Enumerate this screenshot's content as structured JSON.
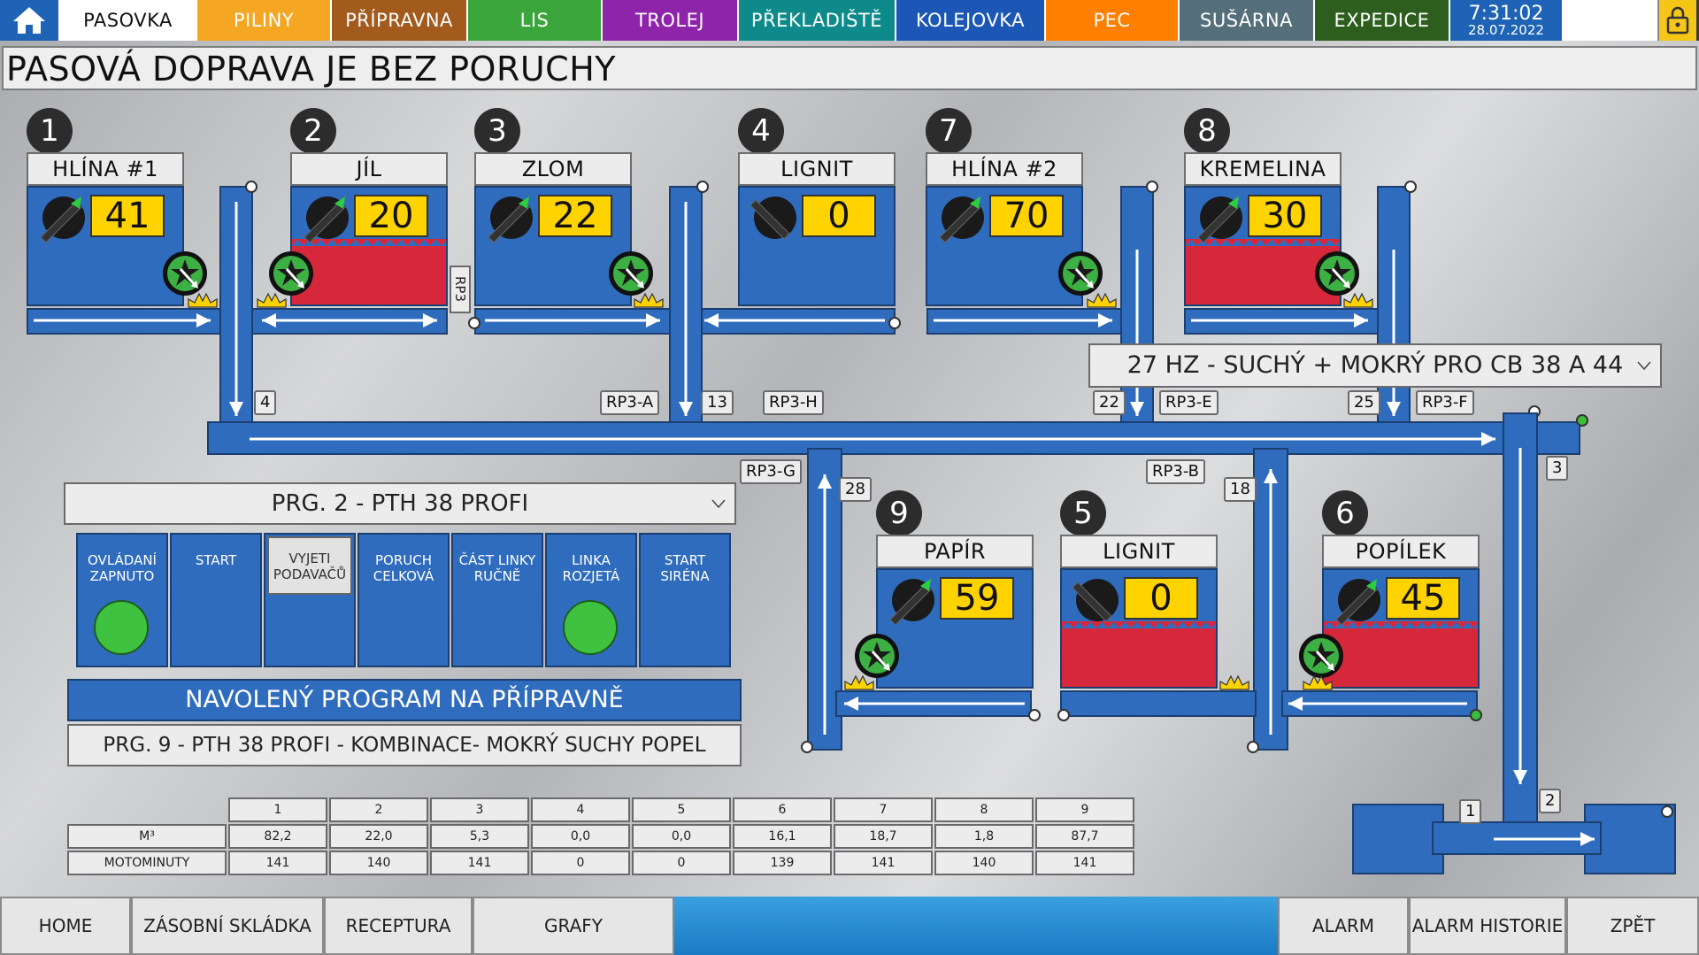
{
  "nav": {
    "tabs": [
      {
        "label": "PASOVKA",
        "color": "#ffffff",
        "active": true,
        "w": 155
      },
      {
        "label": "PILINY",
        "color": "#f5a623",
        "w": 152
      },
      {
        "label": "PŘÍPRAVNA",
        "color": "#a25a1d",
        "w": 154
      },
      {
        "label": "LIS",
        "color": "#3aa53a",
        "w": 152
      },
      {
        "label": "TROLEJ",
        "color": "#8e24aa",
        "w": 154
      },
      {
        "label": "PŘEKLADIŠTĚ",
        "color": "#0e8a8a",
        "w": 178
      },
      {
        "label": "KOLEJOVKA",
        "color": "#1c57b5",
        "w": 169
      },
      {
        "label": "PEC",
        "color": "#ff7f00",
        "w": 151
      },
      {
        "label": "SUŠÁRNA",
        "color": "#546e7a",
        "w": 153
      },
      {
        "label": "EXPEDICE",
        "color": "#2e5e1e",
        "w": 153
      }
    ],
    "time": "7:31:02",
    "date": "28.07.2022"
  },
  "status": "PASOVÁ DOPRAVA JE BEZ PORUCHY",
  "hoppers": [
    {
      "num": "1",
      "name": "HLÍNA #1",
      "value": "41"
    },
    {
      "num": "2",
      "name": "JÍL",
      "value": "20"
    },
    {
      "num": "3",
      "name": "ZLOM",
      "value": "22"
    },
    {
      "num": "4",
      "name": "LIGNIT",
      "value": "0"
    },
    {
      "num": "7",
      "name": "HLÍNA #2",
      "value": "70"
    },
    {
      "num": "8",
      "name": "KREMELINA",
      "value": "30"
    },
    {
      "num": "9",
      "name": "PAPÍR",
      "value": "59"
    },
    {
      "num": "5",
      "name": "LIGNIT",
      "value": "0"
    },
    {
      "num": "6",
      "name": "POPÍLEK",
      "value": "45"
    }
  ],
  "tags": {
    "t4": "4",
    "rp3a": "RP3-A",
    "t13": "13",
    "rp3h": "RP3-H",
    "t22": "22",
    "rp3e": "RP3-E",
    "t25": "25",
    "rp3f": "RP3-F",
    "rp3g": "RP3-G",
    "t28": "28",
    "rp3b": "RP3-B",
    "t18": "18",
    "t3": "3",
    "t1": "1",
    "t2": "2",
    "rp3v": "RP3"
  },
  "mix_select": "27 HZ - SUCHÝ + MOKRÝ PRO CB 38 A 44",
  "program_select": "PRG. 2 - PTH 38 PROFI",
  "controls": [
    {
      "label": "OVLÁDANÍ ZAPNUTO",
      "lamp": true
    },
    {
      "label": "START"
    },
    {
      "label": "VYJETI PODAVAČŮ",
      "pressed": true
    },
    {
      "label": "PORUCH CELKOVÁ"
    },
    {
      "label": "ČÁST LINKY RUČNĚ"
    },
    {
      "label": "LINKA ROZJETÁ",
      "lamp": true
    },
    {
      "label": "START SIRÉNA"
    }
  ],
  "selected_program_title": "NAVOLENÝ PROGRAM NA PŘÍPRAVNĚ",
  "selected_program": "PRG. 9 - PTH 38 PROFI - KOMBINACE- MOKRÝ SUCHY POPEL",
  "table": {
    "headers": [
      "1",
      "2",
      "3",
      "4",
      "5",
      "6",
      "7",
      "8",
      "9"
    ],
    "rows": [
      {
        "label": "M³",
        "values": [
          "82,2",
          "22,0",
          "5,3",
          "0,0",
          "0,0",
          "16,1",
          "18,7",
          "1,8",
          "87,7"
        ]
      },
      {
        "label": "MOTOMINUTY",
        "values": [
          "141",
          "140",
          "141",
          "0",
          "0",
          "139",
          "141",
          "140",
          "141"
        ]
      }
    ]
  },
  "bottom": {
    "home": "HOME",
    "stock": "ZÁSOBNÍ SKLÁDKA",
    "recipe": "RECEPTURA",
    "graphs": "GRAFY",
    "alarm": "ALARM",
    "alarm_hist": "ALARM HISTORIE",
    "back": "ZPĚT"
  }
}
